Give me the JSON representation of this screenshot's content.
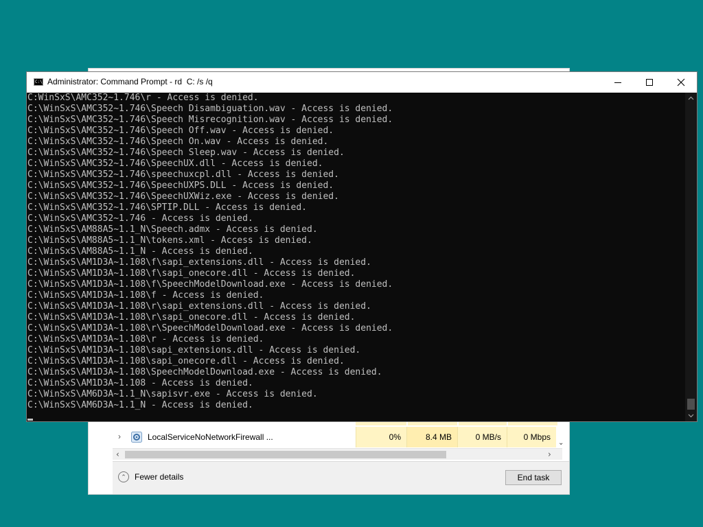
{
  "task_manager": {
    "row": {
      "name": "LocalServiceNoNetworkFirewall ...",
      "cpu": "0%",
      "memory": "8.4 MB",
      "disk": "0 MB/s",
      "network": "0 Mbps"
    },
    "footer": {
      "fewer_details": "Fewer details",
      "end_task": "End task"
    }
  },
  "cmd": {
    "title": "Administrator: Command Prompt - rd  C: /s /q",
    "icon_text": "C:\\",
    "lines": [
      "C:WinSxS\\AMC352~1.746\\r - Access is denied.",
      "C:\\WinSxS\\AMC352~1.746\\Speech Disambiguation.wav - Access is denied.",
      "C:\\WinSxS\\AMC352~1.746\\Speech Misrecognition.wav - Access is denied.",
      "C:\\WinSxS\\AMC352~1.746\\Speech Off.wav - Access is denied.",
      "C:\\WinSxS\\AMC352~1.746\\Speech On.wav - Access is denied.",
      "C:\\WinSxS\\AMC352~1.746\\Speech Sleep.wav - Access is denied.",
      "C:\\WinSxS\\AMC352~1.746\\SpeechUX.dll - Access is denied.",
      "C:\\WinSxS\\AMC352~1.746\\speechuxcpl.dll - Access is denied.",
      "C:\\WinSxS\\AMC352~1.746\\SpeechUXPS.DLL - Access is denied.",
      "C:\\WinSxS\\AMC352~1.746\\SpeechUXWiz.exe - Access is denied.",
      "C:\\WinSxS\\AMC352~1.746\\SPTIP.DLL - Access is denied.",
      "C:\\WinSxS\\AMC352~1.746 - Access is denied.",
      "C:\\WinSxS\\AM88A5~1.1_N\\Speech.admx - Access is denied.",
      "C:\\WinSxS\\AM88A5~1.1_N\\tokens.xml - Access is denied.",
      "C:\\WinSxS\\AM88A5~1.1_N - Access is denied.",
      "C:\\WinSxS\\AM1D3A~1.108\\f\\sapi_extensions.dll - Access is denied.",
      "C:\\WinSxS\\AM1D3A~1.108\\f\\sapi_onecore.dll - Access is denied.",
      "C:\\WinSxS\\AM1D3A~1.108\\f\\SpeechModelDownload.exe - Access is denied.",
      "C:\\WinSxS\\AM1D3A~1.108\\f - Access is denied.",
      "C:\\WinSxS\\AM1D3A~1.108\\r\\sapi_extensions.dll - Access is denied.",
      "C:\\WinSxS\\AM1D3A~1.108\\r\\sapi_onecore.dll - Access is denied.",
      "C:\\WinSxS\\AM1D3A~1.108\\r\\SpeechModelDownload.exe - Access is denied.",
      "C:\\WinSxS\\AM1D3A~1.108\\r - Access is denied.",
      "C:\\WinSxS\\AM1D3A~1.108\\sapi_extensions.dll - Access is denied.",
      "C:\\WinSxS\\AM1D3A~1.108\\sapi_onecore.dll - Access is denied.",
      "C:\\WinSxS\\AM1D3A~1.108\\SpeechModelDownload.exe - Access is denied.",
      "C:\\WinSxS\\AM1D3A~1.108 - Access is denied.",
      "C:\\WinSxS\\AM6D3A~1.1_N\\sapisvr.exe - Access is denied.",
      "C:\\WinSxS\\AM6D3A~1.1_N - Access is denied."
    ]
  },
  "colors": {
    "desktop": "#038387",
    "console_bg": "#0c0c0c",
    "console_text": "#c0c0c0",
    "metric_highlight": "#fff4c4"
  }
}
